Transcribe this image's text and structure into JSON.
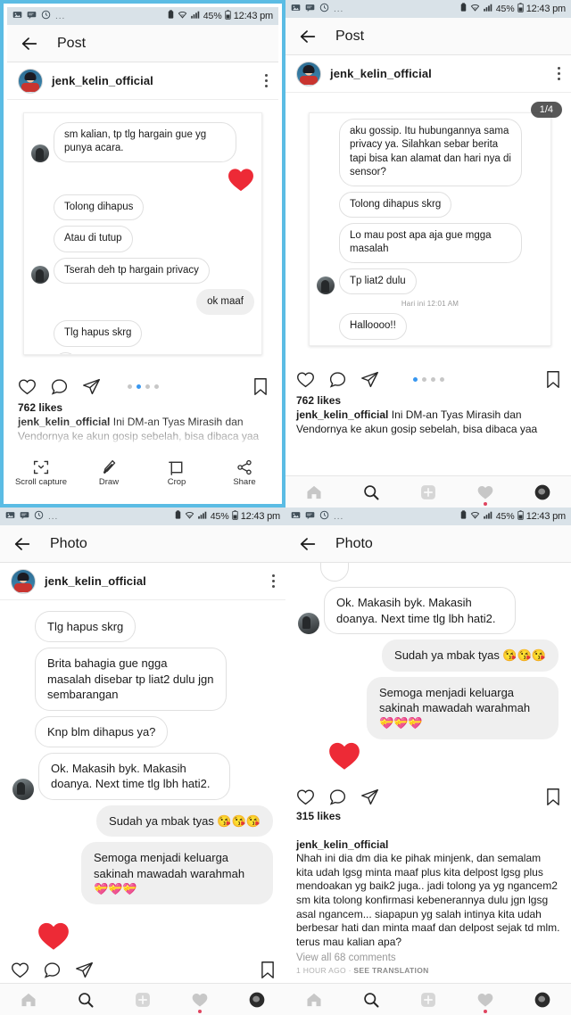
{
  "status_bar": {
    "icons": [
      "image-icon",
      "message-icon",
      "clock-icon"
    ],
    "overflow": "...",
    "battery_percent": "45%",
    "time": "12:43 pm"
  },
  "panels": [
    {
      "id": "panel-top-left",
      "selected": true,
      "app_bar": {
        "title": "Post",
        "back_icon": "back-arrow-icon"
      },
      "post": {
        "username": "jenk_kelin_official",
        "menu_icon": "kebab-menu-icon",
        "likes": "762 likes",
        "caption_user": "jenk_kelin_official",
        "caption_text": "Ini DM-an Tyas Mirasih dan Vendornya ke akun gosip sebelah, bisa dibaca yaa",
        "dots_total": 4,
        "dots_active": 1
      },
      "messages": [
        {
          "side": "in",
          "avatar": true,
          "text": "sm kalian, tp tlg hargain gue yg punya acara."
        },
        {
          "side": "react",
          "text": "❤"
        },
        {
          "side": "in",
          "avatar": false,
          "text": "Tolong dihapus"
        },
        {
          "side": "in",
          "avatar": false,
          "text": "Atau di tutup"
        },
        {
          "side": "in",
          "avatar": true,
          "text": "Tserah deh tp hargain privacy"
        },
        {
          "side": "out",
          "text": "ok maaf"
        },
        {
          "side": "in",
          "avatar": false,
          "text": "Tlg hapus skrg"
        }
      ],
      "capture_toolbar": {
        "items": [
          {
            "icon": "scroll-capture-icon",
            "label": "Scroll capture"
          },
          {
            "icon": "draw-icon",
            "label": "Draw"
          },
          {
            "icon": "crop-icon",
            "label": "Crop"
          },
          {
            "icon": "share-icon",
            "label": "Share"
          }
        ]
      }
    },
    {
      "id": "panel-top-right",
      "selected": false,
      "app_bar": {
        "title": "Post",
        "back_icon": "back-arrow-icon"
      },
      "post": {
        "username": "jenk_kelin_official",
        "menu_icon": "kebab-menu-icon",
        "likes": "762 likes",
        "caption_user": "jenk_kelin_official",
        "caption_text": "Ini DM-an Tyas Mirasih dan Vendornya ke akun gosip sebelah, bisa dibaca yaa",
        "dots_total": 4,
        "dots_active": 0,
        "carousel_badge": "1/4"
      },
      "messages": [
        {
          "side": "in",
          "avatar": false,
          "text": "aku gossip. Itu hubungannya sama privacy ya. Silahkan sebar berita tapi bisa kan alamat dan hari nya di sensor?"
        },
        {
          "side": "in",
          "avatar": false,
          "text": "Tolong dihapus skrg"
        },
        {
          "side": "in",
          "avatar": false,
          "text": "Lo mau post apa aja gue mgga masalah"
        },
        {
          "side": "in",
          "avatar": true,
          "text": "Tp liat2 dulu"
        },
        {
          "side": "time",
          "text": "Hari ini 12:01 AM"
        },
        {
          "side": "in",
          "avatar": false,
          "text": "Halloooo!!"
        }
      ],
      "bottom_nav": [
        "home-icon",
        "search-icon",
        "add-post-icon",
        "activity-heart-icon",
        "profile-icon"
      ]
    },
    {
      "id": "panel-bottom-left",
      "selected": false,
      "app_bar": {
        "title": "Photo",
        "back_icon": "back-arrow-icon"
      },
      "post": {
        "username": "jenk_kelin_official",
        "menu_icon": "kebab-menu-icon"
      },
      "messages": [
        {
          "side": "in",
          "avatar": false,
          "text": "Tlg hapus skrg"
        },
        {
          "side": "in",
          "avatar": false,
          "text": "Brita bahagia gue ngga masalah disebar tp liat2 dulu jgn sembarangan"
        },
        {
          "side": "in",
          "avatar": false,
          "text": "Knp blm dihapus ya?"
        },
        {
          "side": "in",
          "avatar": true,
          "text": "Ok. Makasih byk. Makasih doanya. Next time tlg lbh hati2."
        },
        {
          "side": "out",
          "text": "Sudah ya mbak tyas 😘😘😘"
        },
        {
          "side": "out",
          "text": "Semoga menjadi keluarga sakinah mawadah warahmah 💝💝💝"
        }
      ],
      "bottom_nav": [
        "home-icon",
        "search-icon",
        "add-post-icon",
        "activity-heart-icon",
        "profile-icon"
      ]
    },
    {
      "id": "panel-bottom-right",
      "selected": false,
      "app_bar": {
        "title": "Photo",
        "back_icon": "back-arrow-icon"
      },
      "post": {
        "likes": "315 likes",
        "caption_user": "jenk_kelin_official",
        "caption_text": "Nhah ini dia dm dia ke pihak minjenk, dan semalam kita udah lgsg minta maaf plus kita delpost lgsg plus mendoakan yg baik2 juga.. jadi tolong ya yg ngancem2 sm kita tolong konfirmasi kebenerannya dulu jgn lgsg asal ngancem... siapapun yg salah intinya kita udah berbesar hati dan minta maaf dan delpost sejak td mlm.\nterus mau kalian apa?",
        "view_comments": "View all 68 comments",
        "time_ago": "1 HOUR AGO",
        "separator": "·",
        "translate": "SEE TRANSLATION"
      },
      "messages": [
        {
          "side": "in",
          "avatar": true,
          "text": "Ok. Makasih byk. Makasih doanya. Next time tlg lbh hati2."
        },
        {
          "side": "out",
          "text": "Sudah ya mbak tyas 😘😘😘"
        },
        {
          "side": "out",
          "text": "Semoga menjadi keluarga sakinah mawadah warahmah 💝💝💝"
        }
      ],
      "bottom_nav": [
        "home-icon",
        "search-icon",
        "add-post-icon",
        "activity-heart-icon",
        "profile-icon"
      ]
    }
  ],
  "colors": {
    "selection_border": "#5BBCE4",
    "status_bar_bg": "#d9e2e8",
    "active_dot": "#3897f0",
    "like_heart": "#ed2a36"
  }
}
